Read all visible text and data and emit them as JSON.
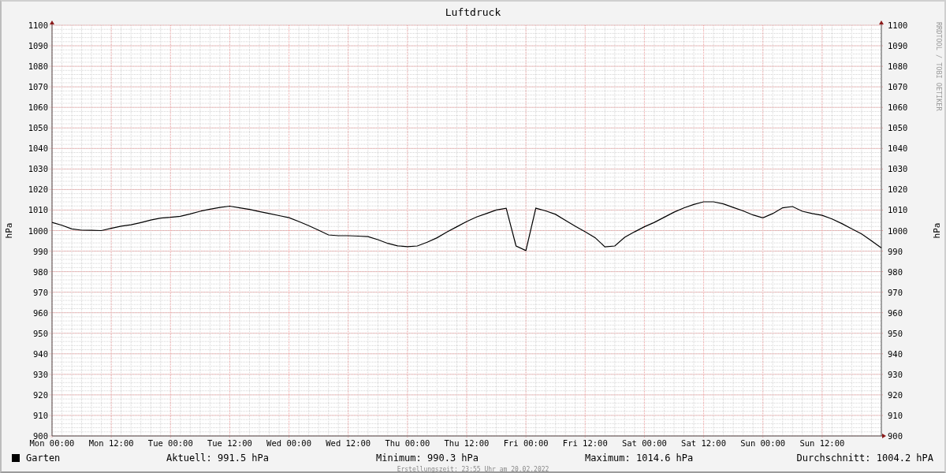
{
  "graph": {
    "credit": "RRDTOOL / TOBI OETIKER",
    "chart_data": {
      "type": "line",
      "title": "Luftdruck",
      "ylabel": "hPa",
      "ylim": [
        900,
        1100
      ],
      "grid": true,
      "categories": [
        "Mon 00:00",
        null,
        null,
        null,
        null,
        null,
        "Mon 12:00",
        null,
        null,
        null,
        null,
        null,
        "Tue 00:00",
        null,
        null,
        null,
        null,
        null,
        "Tue 12:00",
        null,
        null,
        null,
        null,
        null,
        "Wed 00:00",
        null,
        null,
        null,
        null,
        null,
        "Wed 12:00",
        null,
        null,
        null,
        null,
        null,
        "Thu 00:00",
        null,
        null,
        null,
        null,
        null,
        "Thu 12:00",
        null,
        null,
        null,
        null,
        null,
        "Fri 00:00",
        null,
        null,
        null,
        null,
        null,
        "Fri 12:00",
        null,
        null,
        null,
        null,
        null,
        "Sat 00:00",
        null,
        null,
        null,
        null,
        null,
        "Sat 12:00",
        null,
        null,
        null,
        null,
        null,
        "Sun 00:00",
        null,
        null,
        null,
        null,
        null,
        "Sun 12:00",
        null,
        null,
        null,
        null,
        null,
        null
      ],
      "yticks": [
        900,
        910,
        920,
        930,
        940,
        950,
        960,
        970,
        980,
        990,
        1000,
        1010,
        1020,
        1030,
        1040,
        1050,
        1060,
        1070,
        1080,
        1090,
        1100
      ],
      "series": [
        {
          "name": "Garten",
          "color": "#000000",
          "values": [
            1004.0,
            1002.6,
            1000.8,
            1000.2,
            1000.1,
            1000.0,
            1001.1,
            1002.2,
            1002.8,
            1003.9,
            1005.1,
            1006.1,
            1006.5,
            1007.0,
            1008.1,
            1009.4,
            1010.4,
            1011.3,
            1011.9,
            1011.1,
            1010.3,
            1009.3,
            1008.3,
            1007.3,
            1006.3,
            1004.4,
            1002.4,
            1000.2,
            997.9,
            997.5,
            997.5,
            997.3,
            997.1,
            995.6,
            993.8,
            992.6,
            992.2,
            992.5,
            994.3,
            996.5,
            999.3,
            1001.9,
            1004.4,
            1006.6,
            1008.3,
            1010.0,
            1010.9,
            992.5,
            990.3,
            1010.9,
            1009.6,
            1007.9,
            1005.0,
            1002.1,
            999.4,
            996.6,
            992.1,
            992.5,
            996.7,
            999.4,
            1001.9,
            1004.0,
            1006.5,
            1009.0,
            1011.0,
            1012.7,
            1014.0,
            1014.0,
            1013.0,
            1011.3,
            1009.6,
            1007.6,
            1006.2,
            1008.3,
            1011.1,
            1011.7,
            1009.4,
            1008.3,
            1007.4,
            1005.7,
            1003.4,
            1000.9,
            998.4,
            995.0,
            991.5
          ]
        }
      ]
    },
    "right_axis": {
      "label": "hPa",
      "ticks": [
        "1100",
        "1090",
        "1080",
        "1070",
        "1060",
        "1050",
        "1040",
        "1030",
        "1020",
        "1010",
        "1000",
        "990",
        "980",
        "970",
        "960",
        "950",
        "940",
        "930",
        "920",
        "910",
        "900"
      ]
    },
    "legend": {
      "stats": [
        "Aktuell: 991.5 hPa",
        "Minimum: 990.3 hPa",
        "Maximum: 1014.6 hPa",
        "Durchschnitt: 1004.2 hPA"
      ]
    },
    "footer": "Erstellungszeit: 23:55 Uhr am 20.02.2022"
  }
}
